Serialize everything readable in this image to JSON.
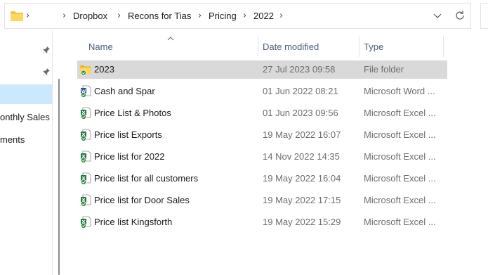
{
  "breadcrumb": {
    "items": [
      "Dropbox",
      "Recons for Tias",
      "Pricing",
      "2022"
    ]
  },
  "icons": {
    "address_folder": "folder-icon",
    "dropdown": "chevron-down-icon",
    "refresh": "refresh-icon",
    "pin": "pin-icon",
    "sort": "sort-ascending-icon",
    "folder": "folder-synced-icon",
    "word_file": "word-document-synced-icon",
    "excel_file": "excel-workbook-synced-icon"
  },
  "nav": {
    "items": [
      "onthly Sales",
      "ments"
    ]
  },
  "columns": {
    "name": "Name",
    "date_modified": "Date modified",
    "type": "Type"
  },
  "files": [
    {
      "name": "2023",
      "date": "27 Jul 2023 09:58",
      "type": "File folder",
      "kind": "folder"
    },
    {
      "name": "Cash and Spar",
      "date": "01 Jun 2022 08:21",
      "type": "Microsoft Word ...",
      "kind": "word"
    },
    {
      "name": "Price List & Photos",
      "date": "01 Jun 2023 09:56",
      "type": "Microsoft Excel ...",
      "kind": "excel"
    },
    {
      "name": "Price list Exports",
      "date": "19 May 2022 16:07",
      "type": "Microsoft Excel ...",
      "kind": "excel"
    },
    {
      "name": "Price list for 2022",
      "date": "14 Nov 2022 14:35",
      "type": "Microsoft Excel ...",
      "kind": "excel"
    },
    {
      "name": "Price list for all customers",
      "date": "19 May 2022 16:04",
      "type": "Microsoft Excel ...",
      "kind": "excel"
    },
    {
      "name": "Price list for Door Sales",
      "date": "19 May 2022 17:15",
      "type": "Microsoft Excel ...",
      "kind": "excel"
    },
    {
      "name": "Price list Kingsforth",
      "date": "19 May 2022 15:29",
      "type": "Microsoft Excel ...",
      "kind": "excel"
    }
  ],
  "colors": {
    "selected_row": "#d9d9d9",
    "nav_selected": "#cce8ff",
    "excel_green": "#1e7145",
    "word_blue": "#2b579a",
    "folder_yellow": "#f4c542",
    "sync_green": "#2e8b3a"
  }
}
